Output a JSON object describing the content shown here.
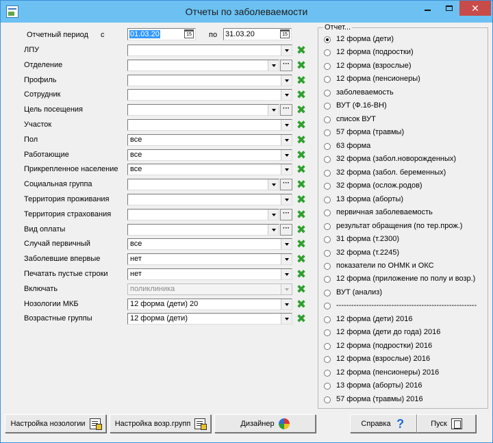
{
  "window": {
    "title": "Отчеты по заболеваемости"
  },
  "period": {
    "label": "Отчетный период",
    "from_label": "с",
    "from": "01.03.20",
    "to_label": "по",
    "to": "31.03.20"
  },
  "fields": [
    {
      "label": "ЛПУ",
      "value": "",
      "ellipsis": false,
      "disabled": false
    },
    {
      "label": "Отделение",
      "value": "",
      "ellipsis": true,
      "disabled": false
    },
    {
      "label": "Профиль",
      "value": "",
      "ellipsis": false,
      "disabled": false
    },
    {
      "label": "Сотрудник",
      "value": "",
      "ellipsis": false,
      "disabled": false
    },
    {
      "label": "Цель посещения",
      "value": "",
      "ellipsis": true,
      "disabled": false
    },
    {
      "label": "Участок",
      "value": "",
      "ellipsis": false,
      "disabled": false
    },
    {
      "label": "Пол",
      "value": "все",
      "ellipsis": false,
      "disabled": false
    },
    {
      "label": "Работающие",
      "value": "все",
      "ellipsis": false,
      "disabled": false
    },
    {
      "label": "Прикрепленное население",
      "value": "все",
      "ellipsis": false,
      "disabled": false
    },
    {
      "label": "Социальная группа",
      "value": "",
      "ellipsis": true,
      "disabled": false
    },
    {
      "label": "Территория  проживания",
      "value": "",
      "ellipsis": false,
      "disabled": false
    },
    {
      "label": "Территория страхования",
      "value": "",
      "ellipsis": true,
      "disabled": false
    },
    {
      "label": "Вид оплаты",
      "value": "",
      "ellipsis": true,
      "disabled": false
    },
    {
      "label": "Случай первичный",
      "value": "все",
      "ellipsis": false,
      "disabled": false
    },
    {
      "label": "Заболевшие впервые",
      "value": "нет",
      "ellipsis": false,
      "disabled": false
    },
    {
      "label": "Печатать пустые строки",
      "value": "нет",
      "ellipsis": false,
      "disabled": false
    },
    {
      "label": "Включать",
      "value": "поликлиника",
      "ellipsis": false,
      "disabled": true
    },
    {
      "label": "Нозологии МКБ",
      "value": "12 форма (дети) 20",
      "ellipsis": false,
      "disabled": false
    },
    {
      "label": "Возрастные группы",
      "value": "12 форма (дети)",
      "ellipsis": false,
      "disabled": false
    }
  ],
  "report_group": {
    "title": "Отчет...",
    "options": [
      {
        "label": "12 форма (дети)",
        "checked": true
      },
      {
        "label": "12 форма (подростки)",
        "checked": false
      },
      {
        "label": "12 форма (взрослые)",
        "checked": false
      },
      {
        "label": "12 форма (пенсионеры)",
        "checked": false
      },
      {
        "label": "заболеваемость",
        "checked": false
      },
      {
        "label": "ВУТ (Ф.16-ВН)",
        "checked": false
      },
      {
        "label": "список ВУТ",
        "checked": false
      },
      {
        "label": "57 форма (травмы)",
        "checked": false
      },
      {
        "label": "63 форма",
        "checked": false
      },
      {
        "label": "32 форма (забол.новорожденных)",
        "checked": false
      },
      {
        "label": "32 форма (забол. беременных)",
        "checked": false
      },
      {
        "label": "32 форма (ослож.родов)",
        "checked": false
      },
      {
        "label": "13 форма (аборты)",
        "checked": false
      },
      {
        "label": "первичная заболеваемость",
        "checked": false
      },
      {
        "label": "результат обращения (по тер.прож.)",
        "checked": false
      },
      {
        "label": "31 форма (т.2300)",
        "checked": false
      },
      {
        "label": "32 форма (т.2245)",
        "checked": false
      },
      {
        "label": "показатели по ОНМК и ОКС",
        "checked": false
      },
      {
        "label": "12 форма (приложение по полу и возр.)",
        "checked": false
      },
      {
        "label": "ВУТ (анализ)",
        "checked": false
      },
      {
        "label": "--------------------------------------------------------",
        "checked": false
      },
      {
        "label": "12 форма (дети) 2016",
        "checked": false
      },
      {
        "label": "12 форма (дети до года) 2016",
        "checked": false
      },
      {
        "label": "12 форма (подростки) 2016",
        "checked": false
      },
      {
        "label": "12 форма (взрослые) 2016",
        "checked": false
      },
      {
        "label": "12 форма (пенсионеры) 2016",
        "checked": false
      },
      {
        "label": "13 форма (аборты) 2016",
        "checked": false
      },
      {
        "label": "57 форма (травмы) 2016",
        "checked": false
      }
    ]
  },
  "buttons": {
    "nosology_settings": "Настройка нозологии",
    "age_group_settings": "Настройка возр.групп",
    "designer": "Дизайнер",
    "help": "Справка",
    "run": "Пуск"
  },
  "icons": {
    "clear": "clear-x-icon",
    "calendar": "calendar-icon",
    "dropdown": "chevron-down-icon"
  },
  "colors": {
    "titlebar": "#6cc1f2",
    "close": "#c74b48",
    "clear_icon": "#2ea12e",
    "selection": "#3399ff"
  }
}
